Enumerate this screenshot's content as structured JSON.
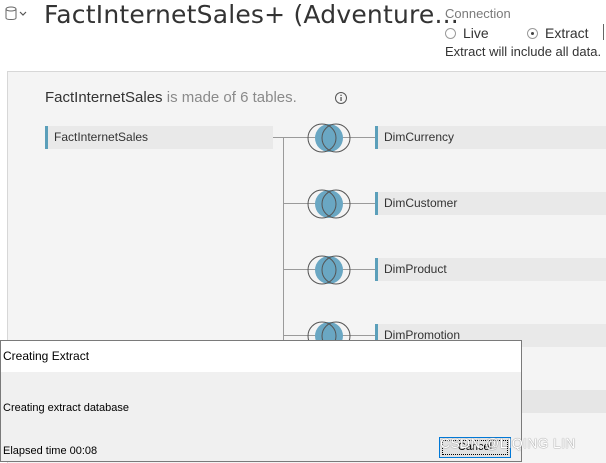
{
  "header": {
    "title": "FactInternetSales+ (Adventure...",
    "datasource_icon": "database-icon",
    "menu_icon": "chevron-down-icon"
  },
  "connection": {
    "label": "Connection",
    "options": [
      {
        "label": "Live",
        "selected": false
      },
      {
        "label": "Extract",
        "selected": true
      }
    ],
    "note": "Extract will include all data."
  },
  "canvas": {
    "summary_name": "FactInternetSales",
    "summary_rest": " is made of 6 tables.",
    "info_icon": "info-icon",
    "left_table": "FactInternetSales",
    "joined_tables": [
      "DimCurrency",
      "DimCustomer",
      "DimProduct",
      "DimPromotion"
    ],
    "join_type": "inner",
    "colors": {
      "accent": "#5b9fba",
      "venn_fill": "#6aa7c3",
      "box_bg": "#e9e9e9",
      "canvas_bg": "#f4f4f4"
    }
  },
  "dialog": {
    "title": "Creating Extract",
    "status": "Creating extract database",
    "elapsed": "Elapsed time 00:08",
    "cancel_label": "Cancel"
  },
  "watermark": "CSDN @LIQING LIN"
}
